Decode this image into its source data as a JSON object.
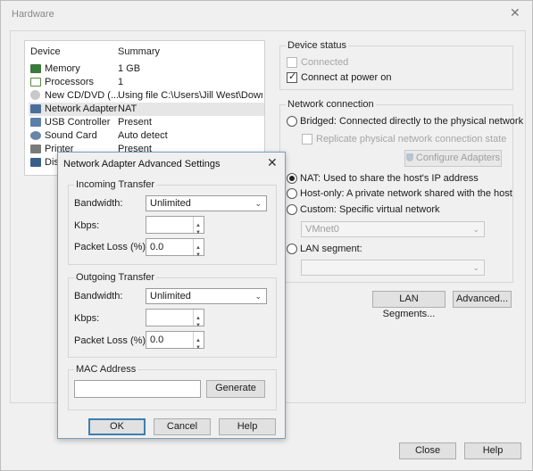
{
  "window": {
    "title": "Hardware",
    "close_glyph": "✕"
  },
  "device_list": {
    "headers": {
      "device": "Device",
      "summary": "Summary"
    },
    "items": [
      {
        "device": "Memory",
        "summary": "1 GB",
        "icon": "memory-icon",
        "color": "#3a7a3a"
      },
      {
        "device": "Processors",
        "summary": "1",
        "icon": "processor-icon",
        "color": "#5a8a3c"
      },
      {
        "device": "New CD/DVD (...",
        "summary": "Using file C:\\Users\\Jill West\\Downl...",
        "icon": "cd-dvd-icon",
        "color": "#8a8a8a"
      },
      {
        "device": "Network Adapter",
        "summary": "NAT",
        "icon": "network-adapter-icon",
        "color": "#4a6f9a"
      },
      {
        "device": "USB Controller",
        "summary": "Present",
        "icon": "usb-icon",
        "color": "#4a6f9a"
      },
      {
        "device": "Sound Card",
        "summary": "Auto detect",
        "icon": "sound-card-icon",
        "color": "#5a7a9a"
      },
      {
        "device": "Printer",
        "summary": "Present",
        "icon": "printer-icon",
        "color": "#6a6a6a"
      },
      {
        "device": "Disp",
        "summary": "",
        "icon": "display-icon",
        "color": "#3a5f8a"
      }
    ]
  },
  "device_status": {
    "label": "Device status",
    "connected": {
      "label": "Connected",
      "checked": false,
      "enabled": false
    },
    "connect_at_power_on": {
      "label": "Connect at power on",
      "checked": true
    }
  },
  "network_connection": {
    "label": "Network connection",
    "bridged": "Bridged: Connected directly to the physical network",
    "replicate": "Replicate physical network connection state",
    "configure_adapters": "Configure Adapters",
    "nat": "NAT: Used to share the host's IP address",
    "host_only": "Host-only: A private network shared with the host",
    "custom": "Custom: Specific virtual network",
    "custom_select_value": "VMnet0",
    "lan_segment": "LAN segment:",
    "lan_segment_value": "",
    "selected": "nat"
  },
  "buttons": {
    "lan_segments": "LAN Segments...",
    "advanced": "Advanced...",
    "close": "Close",
    "help": "Help"
  },
  "advanced_dialog": {
    "title": "Network Adapter Advanced Settings",
    "close_glyph": "✕",
    "incoming": {
      "label": "Incoming Transfer",
      "bandwidth_label": "Bandwidth:",
      "bandwidth_value": "Unlimited",
      "kbps_label": "Kbps:",
      "kbps_value": "",
      "packet_loss_label": "Packet Loss (%):",
      "packet_loss_value": "0.0"
    },
    "outgoing": {
      "label": "Outgoing Transfer",
      "bandwidth_label": "Bandwidth:",
      "bandwidth_value": "Unlimited",
      "kbps_label": "Kbps:",
      "kbps_value": "",
      "packet_loss_label": "Packet Loss (%):",
      "packet_loss_value": "0.0"
    },
    "mac": {
      "label": "MAC Address",
      "value": "",
      "generate": "Generate"
    },
    "ok": "OK",
    "cancel": "Cancel",
    "help": "Help"
  },
  "colors": {
    "accent": "#3c7fb1",
    "selected_row": "#e6e6e6"
  }
}
